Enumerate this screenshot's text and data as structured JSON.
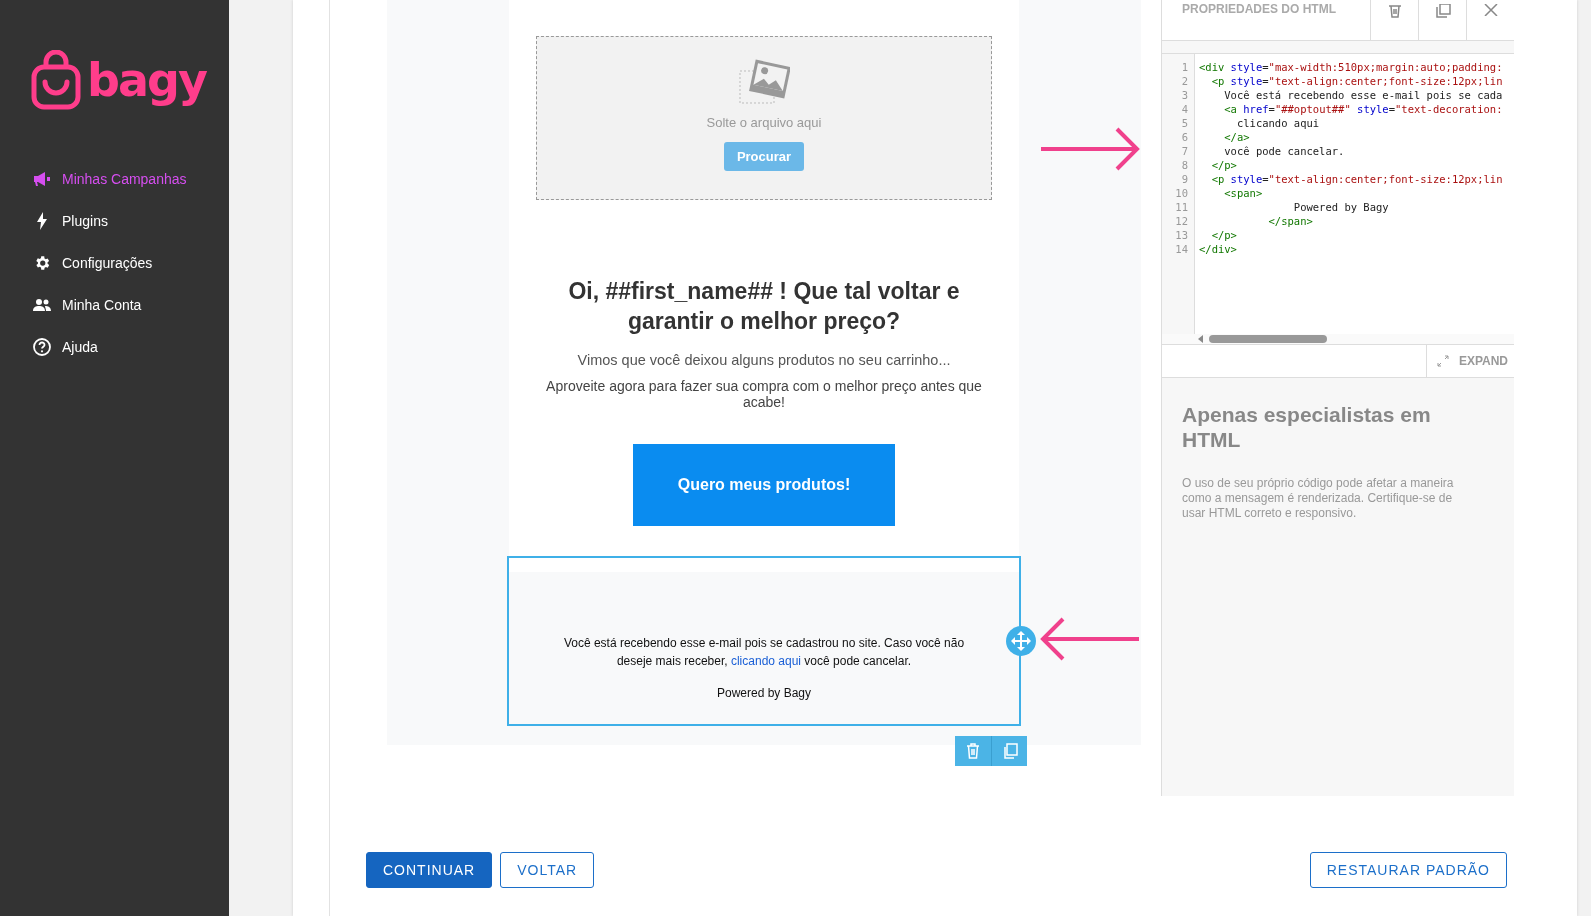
{
  "sidebar": {
    "logo": "bagy",
    "items": [
      {
        "label": "Minhas Campanhas",
        "selected": true
      },
      {
        "label": "Plugins",
        "selected": false
      },
      {
        "label": "Configurações",
        "selected": false
      },
      {
        "label": "Minha Conta",
        "selected": false
      },
      {
        "label": "Ajuda",
        "selected": false
      }
    ]
  },
  "email": {
    "dropzone": {
      "hint": "Solte o arquivo aqui",
      "button": "Procurar"
    },
    "heading": "Oi, ##first_name## ! Que tal voltar e garantir o melhor preço?",
    "paragraphs": [
      "Vimos que você deixou alguns produtos no seu carrinho...",
      "Aproveite agora para fazer sua compra com o melhor preço antes que acabe!"
    ],
    "cta": "Quero meus produtos!",
    "footer": {
      "selected": true,
      "before": "Você está recebendo esse e-mail pois se cadastrou no site. Caso você não deseje mais receber, ",
      "link": "clicando aqui",
      "after": " você pode cancelar.",
      "powered": "Powered by Bagy"
    }
  },
  "panel": {
    "title": "PROPRIEDADES DO HTML",
    "code_lines": [
      {
        "number": "1",
        "tokens": [
          {
            "kind": "tag",
            "text": "<div"
          },
          {
            "kind": "attr",
            "text": " style"
          },
          {
            "kind": "plain",
            "text": "="
          },
          {
            "kind": "string",
            "text": "\"max-width:510px;margin:auto;padding:"
          }
        ]
      },
      {
        "number": "2",
        "tokens": [
          {
            "kind": "tag",
            "text": "  <p"
          },
          {
            "kind": "attr",
            "text": " style"
          },
          {
            "kind": "plain",
            "text": "="
          },
          {
            "kind": "string",
            "text": "\"text-align:center;font-size:12px;lin"
          }
        ]
      },
      {
        "number": "3",
        "tokens": [
          {
            "kind": "plain",
            "text": "    Você está recebendo esse e-mail pois se cada"
          }
        ]
      },
      {
        "number": "4",
        "tokens": [
          {
            "kind": "tag",
            "text": "    <a"
          },
          {
            "kind": "attr",
            "text": " href"
          },
          {
            "kind": "plain",
            "text": "="
          },
          {
            "kind": "string",
            "text": "\"##optout##\""
          },
          {
            "kind": "attr",
            "text": " style"
          },
          {
            "kind": "plain",
            "text": "="
          },
          {
            "kind": "string",
            "text": "\"text-decoration:"
          }
        ]
      },
      {
        "number": "5",
        "tokens": [
          {
            "kind": "plain",
            "text": "      clicando aqui"
          }
        ]
      },
      {
        "number": "6",
        "tokens": [
          {
            "kind": "tag",
            "text": "    </a>"
          }
        ]
      },
      {
        "number": "7",
        "tokens": [
          {
            "kind": "plain",
            "text": "    você pode cancelar."
          }
        ]
      },
      {
        "number": "8",
        "tokens": [
          {
            "kind": "tag",
            "text": "  </p>"
          }
        ]
      },
      {
        "number": "9",
        "tokens": [
          {
            "kind": "tag",
            "text": "  <p"
          },
          {
            "kind": "attr",
            "text": " style"
          },
          {
            "kind": "plain",
            "text": "="
          },
          {
            "kind": "string",
            "text": "\"text-align:center;font-size:12px;lin"
          }
        ]
      },
      {
        "number": "10",
        "tokens": [
          {
            "kind": "tag",
            "text": "    <span>"
          }
        ]
      },
      {
        "number": "11",
        "tokens": [
          {
            "kind": "plain",
            "text": "               Powered by Bagy"
          }
        ]
      },
      {
        "number": "12",
        "tokens": [
          {
            "kind": "tag",
            "text": "           </span>"
          }
        ]
      },
      {
        "number": "13",
        "tokens": [
          {
            "kind": "tag",
            "text": "  </p>"
          }
        ]
      },
      {
        "number": "14",
        "tokens": [
          {
            "kind": "tag",
            "text": "</div>"
          }
        ]
      }
    ],
    "expand": "EXPAND",
    "info_title": "Apenas especialistas em HTML",
    "info_text": "O uso de seu próprio código pode afetar a maneira como a mensagem é renderizada. Certifique-se de usar HTML correto e responsivo."
  },
  "actions": {
    "continue": "CONTINUAR",
    "back": "VOLTAR",
    "restore": "RESTAURAR PADRÃO"
  }
}
